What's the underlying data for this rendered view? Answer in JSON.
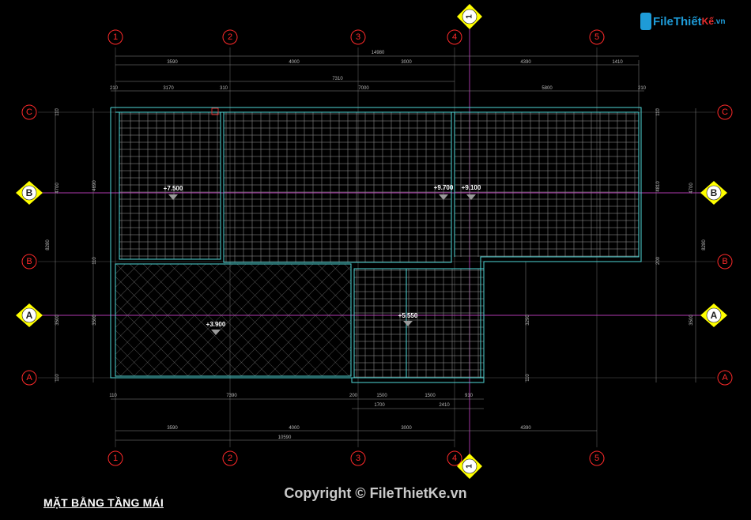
{
  "plan_title": "MẶT BẰNG TẦNG MÁI",
  "copyright": "Copyright © FileThietKe.vn",
  "logo": {
    "main": "FileThiết",
    "accent": "Kế",
    "suffix": ".vn"
  },
  "grid_x_labels": [
    "1",
    "2",
    "3",
    "4",
    "5"
  ],
  "grid_y_labels": [
    "C",
    "B",
    "B",
    "A",
    "A"
  ],
  "section_labels": [
    "B",
    "A"
  ],
  "section_number": "1",
  "elevations": [
    "+7.500",
    "+9.700",
    "+9.100",
    "+3.900",
    "+5.550"
  ],
  "top_dims": {
    "overall": "14980",
    "row1": [
      "3590",
      "4000",
      "3000",
      "4390",
      "1410"
    ],
    "sub": "7310",
    "row3": [
      "210",
      "3170",
      "310",
      "7000",
      "5800",
      "210"
    ]
  },
  "bottom_dims": {
    "row1": [
      "110",
      "7390",
      "200",
      "1500",
      "1500",
      "910"
    ],
    "row2": [
      "1700",
      "2410"
    ],
    "row3": [
      "3590",
      "4000",
      "3000",
      "4390"
    ],
    "overall": "10590"
  },
  "left_dims": [
    "110",
    "4690",
    "4700",
    "110",
    "8280",
    "3500",
    "3500",
    "110"
  ],
  "right_dims": [
    "110",
    "4810",
    "4700",
    "200",
    "8280",
    "3290",
    "3500",
    "110"
  ],
  "colors": {
    "background": "#000000",
    "grid_bubble": "#ff2a2a",
    "outline": "#4fd8d8",
    "roof_tiles": "#8f8f8f",
    "section_axis": "#b13ab1",
    "section_marker": "#ffff00"
  }
}
